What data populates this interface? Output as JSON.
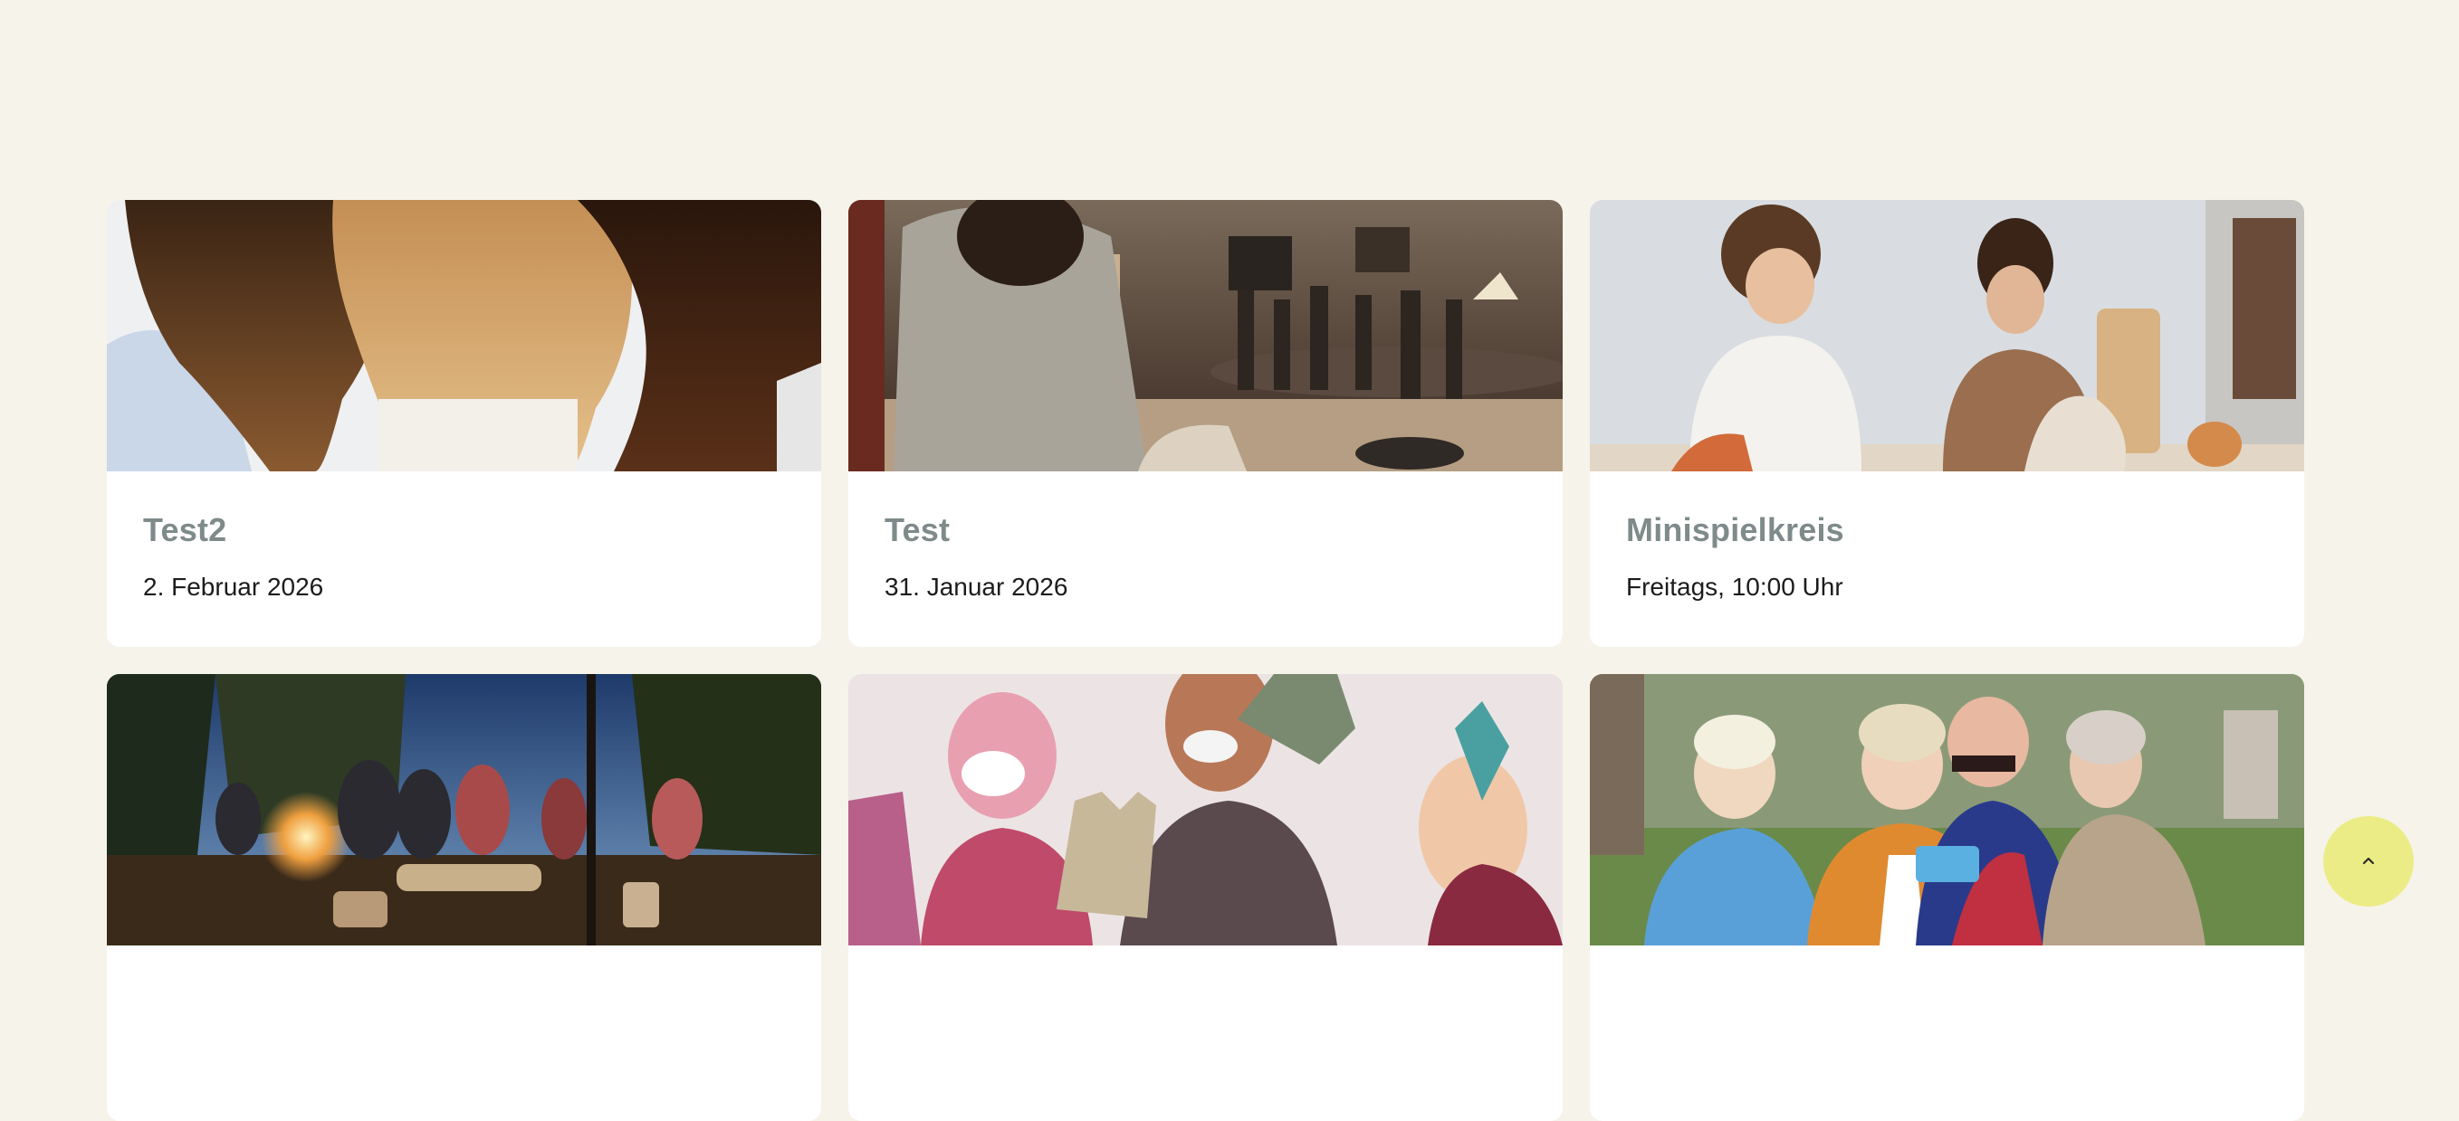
{
  "cards": [
    {
      "title": "Test2",
      "date": "2. Februar 2026",
      "image": "girls-hair-from-behind-photo"
    },
    {
      "title": "Test",
      "date": "31. Januar 2026",
      "image": "living-room-concert-photo"
    },
    {
      "title": "Minispielkreis",
      "date": "Freitags, 10:00 Uhr",
      "image": "toddlers-playing-photo"
    },
    {
      "title": "",
      "date": "",
      "image": "campfire-group-photo"
    },
    {
      "title": "",
      "date": "",
      "image": "color-powder-teens-photo"
    },
    {
      "title": "",
      "date": "",
      "image": "seniors-selfie-photo"
    }
  ],
  "scroll_top": {
    "icon": "chevron-up-icon",
    "color": "#ecec86"
  },
  "colors": {
    "background": "#f6f3ea",
    "card": "#ffffff",
    "title": "#7f8a8a"
  }
}
